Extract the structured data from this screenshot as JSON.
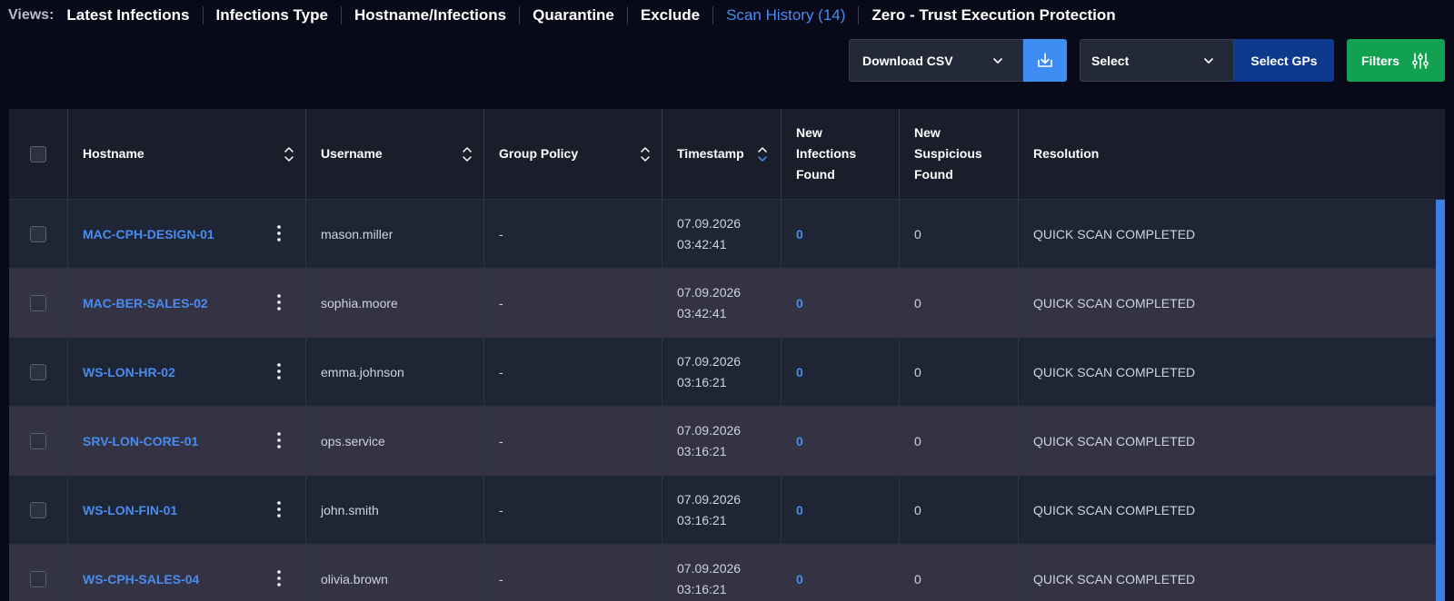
{
  "views": {
    "label": "Views:",
    "items": [
      "Latest Infections",
      "Infections Type",
      "Hostname/Infections",
      "Quarantine",
      "Exclude",
      "Scan History (14)",
      "Zero - Trust Execution Protection"
    ],
    "active_index": 5
  },
  "toolbar": {
    "csv_select": "Download CSV",
    "gp_select": "Select",
    "gp_button": "Select GPs",
    "filters_button": "Filters"
  },
  "table": {
    "headers": {
      "hostname": "Hostname",
      "username": "Username",
      "group_policy": "Group Policy",
      "timestamp": "Timestamp",
      "new_infections_1": "New",
      "new_infections_2": "Infections",
      "new_infections_3": "Found",
      "new_suspicious_1": "New",
      "new_suspicious_2": "Suspicious",
      "new_suspicious_3": "Found",
      "resolution": "Resolution"
    },
    "rows": [
      {
        "hostname": "MAC-CPH-DESIGN-01",
        "username": "mason.miller",
        "group_policy": "-",
        "date": "07.09.2026",
        "time": "03:42:41",
        "new_infections": "0",
        "new_suspicious": "0",
        "resolution": "QUICK SCAN COMPLETED"
      },
      {
        "hostname": "MAC-BER-SALES-02",
        "username": "sophia.moore",
        "group_policy": "-",
        "date": "07.09.2026",
        "time": "03:42:41",
        "new_infections": "0",
        "new_suspicious": "0",
        "resolution": "QUICK SCAN COMPLETED"
      },
      {
        "hostname": "WS-LON-HR-02",
        "username": "emma.johnson",
        "group_policy": "-",
        "date": "07.09.2026",
        "time": "03:16:21",
        "new_infections": "0",
        "new_suspicious": "0",
        "resolution": "QUICK SCAN COMPLETED"
      },
      {
        "hostname": "SRV-LON-CORE-01",
        "username": "ops.service",
        "group_policy": "-",
        "date": "07.09.2026",
        "time": "03:16:21",
        "new_infections": "0",
        "new_suspicious": "0",
        "resolution": "QUICK SCAN COMPLETED"
      },
      {
        "hostname": "WS-LON-FIN-01",
        "username": "john.smith",
        "group_policy": "-",
        "date": "07.09.2026",
        "time": "03:16:21",
        "new_infections": "0",
        "new_suspicious": "0",
        "resolution": "QUICK SCAN COMPLETED"
      },
      {
        "hostname": "WS-CPH-SALES-04",
        "username": "olivia.brown",
        "group_policy": "-",
        "date": "07.09.2026",
        "time": "03:16:21",
        "new_infections": "0",
        "new_suspicious": "0",
        "resolution": "QUICK SCAN COMPLETED"
      }
    ]
  },
  "colors": {
    "background": "#080a1a",
    "accent_blue": "#4a8bf0",
    "download_blue": "#3e8df2",
    "gp_button": "#0d3a8c",
    "filters_green": "#12a150"
  },
  "icons": {
    "dropdown": "chevron-down-icon",
    "download": "download-icon",
    "filters": "sliders-icon",
    "sort": "sort-icon",
    "row_menu": "kebab-menu-icon"
  }
}
